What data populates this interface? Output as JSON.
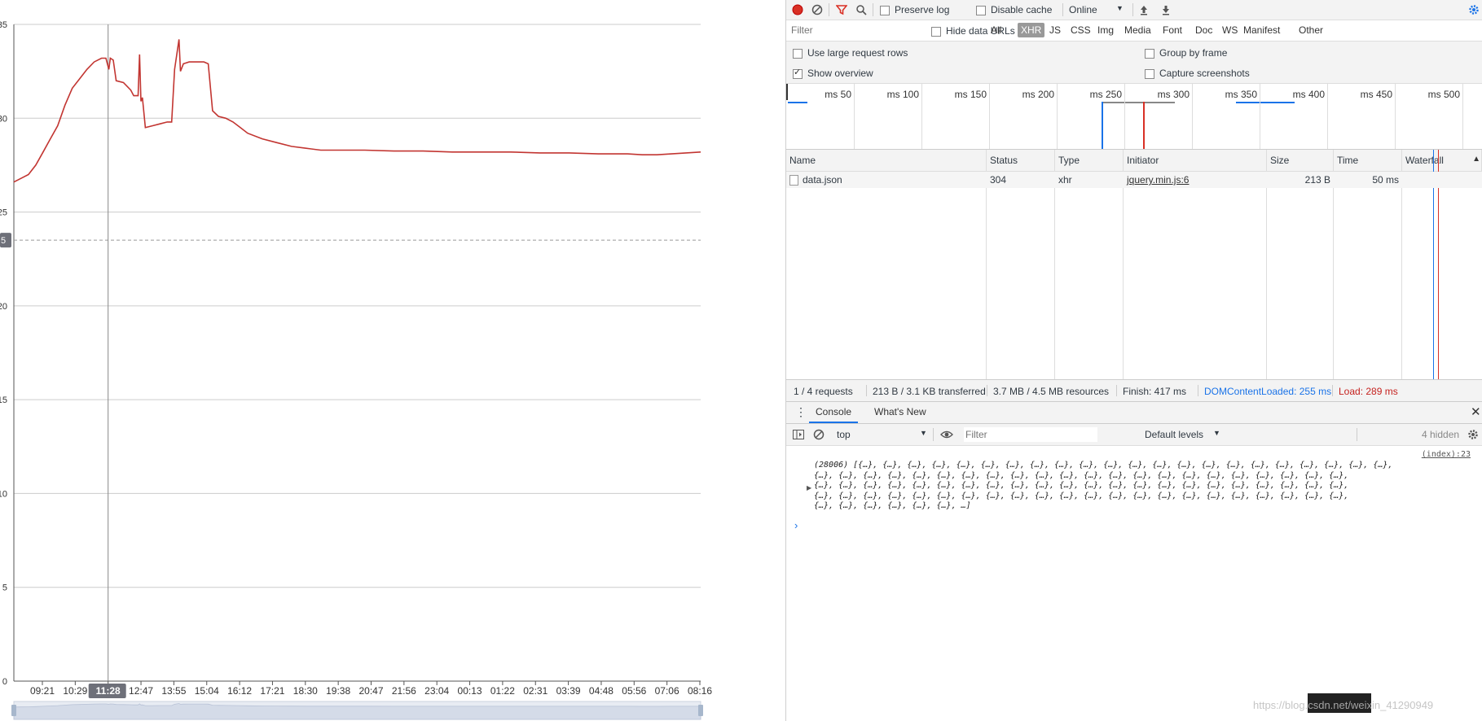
{
  "chart_data": {
    "type": "line",
    "y_ticks": [
      "35",
      "30",
      "25",
      "20",
      "15",
      "10",
      "5",
      "0"
    ],
    "ylim": [
      0,
      35
    ],
    "reference_line_label": "5",
    "reference_line_value": 23.5,
    "x_ticks": [
      "09:21",
      "10:29",
      "11:28",
      "12:47",
      "13:55",
      "15:04",
      "16:12",
      "17:21",
      "18:30",
      "19:38",
      "20:47",
      "21:56",
      "23:04",
      "00:13",
      "01:22",
      "02:31",
      "03:39",
      "04:48",
      "05:56",
      "07:06",
      "08:16"
    ],
    "x_highlighted": "11:28",
    "series": [
      {
        "color": "#c23531",
        "points": [
          [
            0,
            26.6
          ],
          [
            0.5,
            26.8
          ],
          [
            1,
            27.0
          ],
          [
            1.5,
            27.5
          ],
          [
            2,
            28.2
          ],
          [
            2.5,
            28.9
          ],
          [
            3,
            29.6
          ],
          [
            3.5,
            30.7
          ],
          [
            4,
            31.6
          ],
          [
            4.5,
            32.1
          ],
          [
            5,
            32.6
          ],
          [
            5.5,
            33.0
          ],
          [
            6,
            33.2
          ],
          [
            6.3,
            33.2
          ],
          [
            6.5,
            32.6
          ],
          [
            6.6,
            33.2
          ],
          [
            6.8,
            33.1
          ],
          [
            7,
            32.0
          ],
          [
            7.5,
            31.9
          ],
          [
            8,
            31.5
          ],
          [
            8.2,
            31.2
          ],
          [
            8.5,
            31.2
          ],
          [
            8.6,
            33.4
          ],
          [
            8.7,
            30.9
          ],
          [
            8.8,
            31.1
          ],
          [
            9,
            29.5
          ],
          [
            9.5,
            29.6
          ],
          [
            10,
            29.7
          ],
          [
            10.5,
            29.8
          ],
          [
            10.8,
            29.8
          ],
          [
            11,
            32.6
          ],
          [
            11.3,
            34.2
          ],
          [
            11.4,
            32.5
          ],
          [
            11.6,
            32.9
          ],
          [
            12,
            33.0
          ],
          [
            12.5,
            33.0
          ],
          [
            13,
            33.0
          ],
          [
            13.3,
            32.9
          ],
          [
            13.6,
            30.4
          ],
          [
            14,
            30.1
          ],
          [
            14.5,
            30.0
          ],
          [
            15,
            29.8
          ],
          [
            15.5,
            29.5
          ],
          [
            16,
            29.2
          ],
          [
            17,
            28.9
          ],
          [
            18,
            28.7
          ],
          [
            19,
            28.5
          ],
          [
            20,
            28.4
          ],
          [
            21,
            28.3
          ],
          [
            22,
            28.3
          ],
          [
            24,
            28.3
          ],
          [
            26,
            28.25
          ],
          [
            28,
            28.25
          ],
          [
            30,
            28.2
          ],
          [
            32,
            28.2
          ],
          [
            34,
            28.2
          ],
          [
            36,
            28.15
          ],
          [
            38,
            28.15
          ],
          [
            40,
            28.1
          ],
          [
            42,
            28.1
          ],
          [
            43,
            28.05
          ],
          [
            44,
            28.05
          ],
          [
            45,
            28.1
          ],
          [
            46,
            28.15
          ],
          [
            47,
            28.2
          ]
        ]
      }
    ]
  },
  "devtools": {
    "toolbar": {
      "preserve_log": "Preserve log",
      "disable_cache": "Disable cache",
      "throttling": "Online"
    },
    "filter": {
      "placeholder": "Filter",
      "hide_data_urls": "Hide data URLs",
      "types": [
        "All",
        "XHR",
        "JS",
        "CSS",
        "Img",
        "Media",
        "Font",
        "Doc",
        "WS",
        "Manifest",
        "Other"
      ],
      "active_type": "XHR"
    },
    "options": {
      "large_rows": "Use large request rows",
      "group_by_frame": "Group by frame",
      "show_overview": "Show overview",
      "capture_screenshots": "Capture screenshots"
    },
    "timeline_ticks": [
      "50 ms",
      "100 ms",
      "150 ms",
      "200 ms",
      "250 ms",
      "300 ms",
      "350 ms",
      "400 ms",
      "450 ms",
      "500 ms"
    ],
    "table": {
      "columns": [
        "Name",
        "Status",
        "Type",
        "Initiator",
        "Size",
        "Time",
        "Waterfall"
      ],
      "rows": [
        {
          "name": "data.json",
          "status": "304",
          "type": "xhr",
          "initiator": "jquery.min.js:6",
          "size": "213 B",
          "time": "50 ms"
        }
      ]
    },
    "summary": {
      "requests": "1 / 4 requests",
      "transferred": "213 B / 3.1 KB transferred",
      "resources": "3.7 MB / 4.5 MB resources",
      "finish": "Finish: 417 ms",
      "dcl": "DOMContentLoaded: 255 ms",
      "load": "Load: 289 ms",
      "dcl_color": "#1a73e8",
      "load_color": "#c5221f"
    },
    "drawer_tabs": [
      "Console",
      "What's New"
    ],
    "console": {
      "context": "top",
      "filter_placeholder": "Filter",
      "levels": "Default levels",
      "hidden": "4 hidden",
      "source_link": "(index):23",
      "log_lines": [
        "(28006) [{…}, {…}, {…}, {…}, {…}, {…}, {…}, {…}, {…}, {…}, {…}, {…}, {…}, {…}, {…}, {…}, {…}, {…}, {…}, {…}, {…}, {…},",
        "{…}, {…}, {…}, {…}, {…}, {…}, {…}, {…}, {…}, {…}, {…}, {…}, {…}, {…}, {…}, {…}, {…}, {…}, {…}, {…}, {…}, {…},",
        "{…}, {…}, {…}, {…}, {…}, {…}, {…}, {…}, {…}, {…}, {…}, {…}, {…}, {…}, {…}, {…}, {…}, {…}, {…}, {…}, {…}, {…},",
        "{…}, {…}, {…}, {…}, {…}, {…}, {…}, {…}, {…}, {…}, {…}, {…}, {…}, {…}, {…}, {…}, {…}, {…}, {…}, {…}, {…}, {…},",
        "{…}, {…}, {…}, {…}, {…}, {…}, …]"
      ]
    }
  },
  "watermark": "https://blog.csdn.net/weixin_41290949"
}
